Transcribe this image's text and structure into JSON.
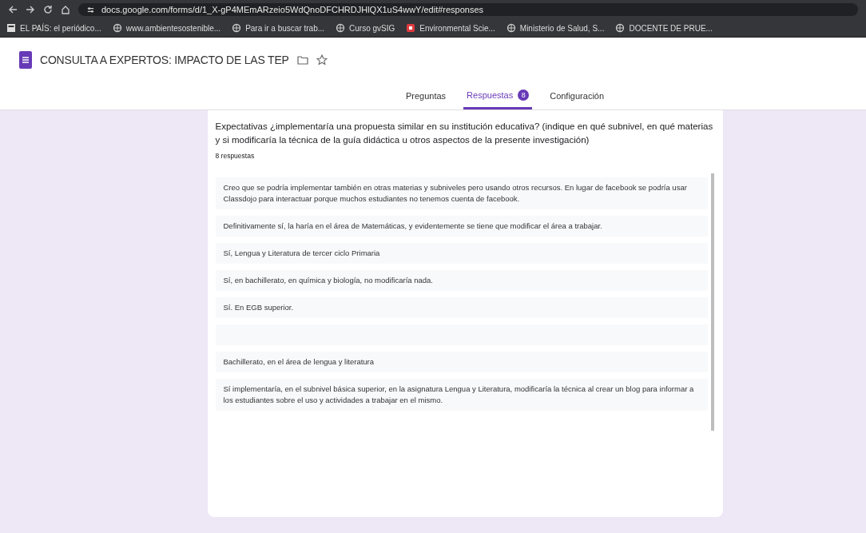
{
  "browser": {
    "url": "docs.google.com/forms/d/1_X-gP4MEmARzeio5WdQnoDFCHRDJHlQX1uS4wwY/edit#responses",
    "bookmarks": [
      {
        "label": "EL PAÍS: el periódico...",
        "kind": "news"
      },
      {
        "label": "www.ambientesostenible...",
        "kind": "globe"
      },
      {
        "label": "Para ir a buscar trab...",
        "kind": "globe"
      },
      {
        "label": "Curso gvSIG",
        "kind": "globe"
      },
      {
        "label": "Environmental Scie...",
        "kind": "red"
      },
      {
        "label": "Ministerio de Salud, S...",
        "kind": "globe"
      },
      {
        "label": "DOCENTE DE PRUE...",
        "kind": "globe"
      }
    ]
  },
  "form": {
    "title": "CONSULTA A EXPERTOS: IMPACTO DE LAS TEP"
  },
  "tabs": [
    {
      "label": "Preguntas",
      "selected": false
    },
    {
      "label": "Respuestas",
      "selected": true,
      "badge": "8"
    },
    {
      "label": "Configuración",
      "selected": false
    }
  ],
  "question": {
    "text": "Expectativas ¿implementaría una propuesta similar en su institución educativa? (indique en qué subnivel, en qué materias y si modificaría la técnica de la guía didáctica u otros aspectos de la presente investigación)",
    "count": "8 respuestas"
  },
  "responses": [
    {
      "kind": "text",
      "text": "Creo que se podría implementar también en otras materias y subniveles pero usando otros recursos. En lugar de facebook se podría usar Classdojo para interactuar porque muchos estudiantes no tenemos cuenta de facebook."
    },
    {
      "kind": "text",
      "text": "Definitivamente sí, la haría en el área de Matemáticas, y evidentemente se tiene que modificar el área a trabajar."
    },
    {
      "kind": "text",
      "text": "Sí, Lengua y Literatura de tercer ciclo Primaria"
    },
    {
      "kind": "text",
      "text": "Sí, en bachillerato, en química y biología, no modificaría nada."
    },
    {
      "kind": "text",
      "text": "Sí. En EGB superior."
    },
    {
      "kind": "empty"
    },
    {
      "kind": "text",
      "text": "Bachillerato, en el área de lengua y literatura"
    },
    {
      "kind": "text",
      "text": "Sí implementaría, en el subnivel básica superior, en la asignatura Lengua y Literatura, modificaría la técnica al crear un blog para informar a los estudiantes sobre el uso y actividades a trabajar en el mismo."
    }
  ]
}
